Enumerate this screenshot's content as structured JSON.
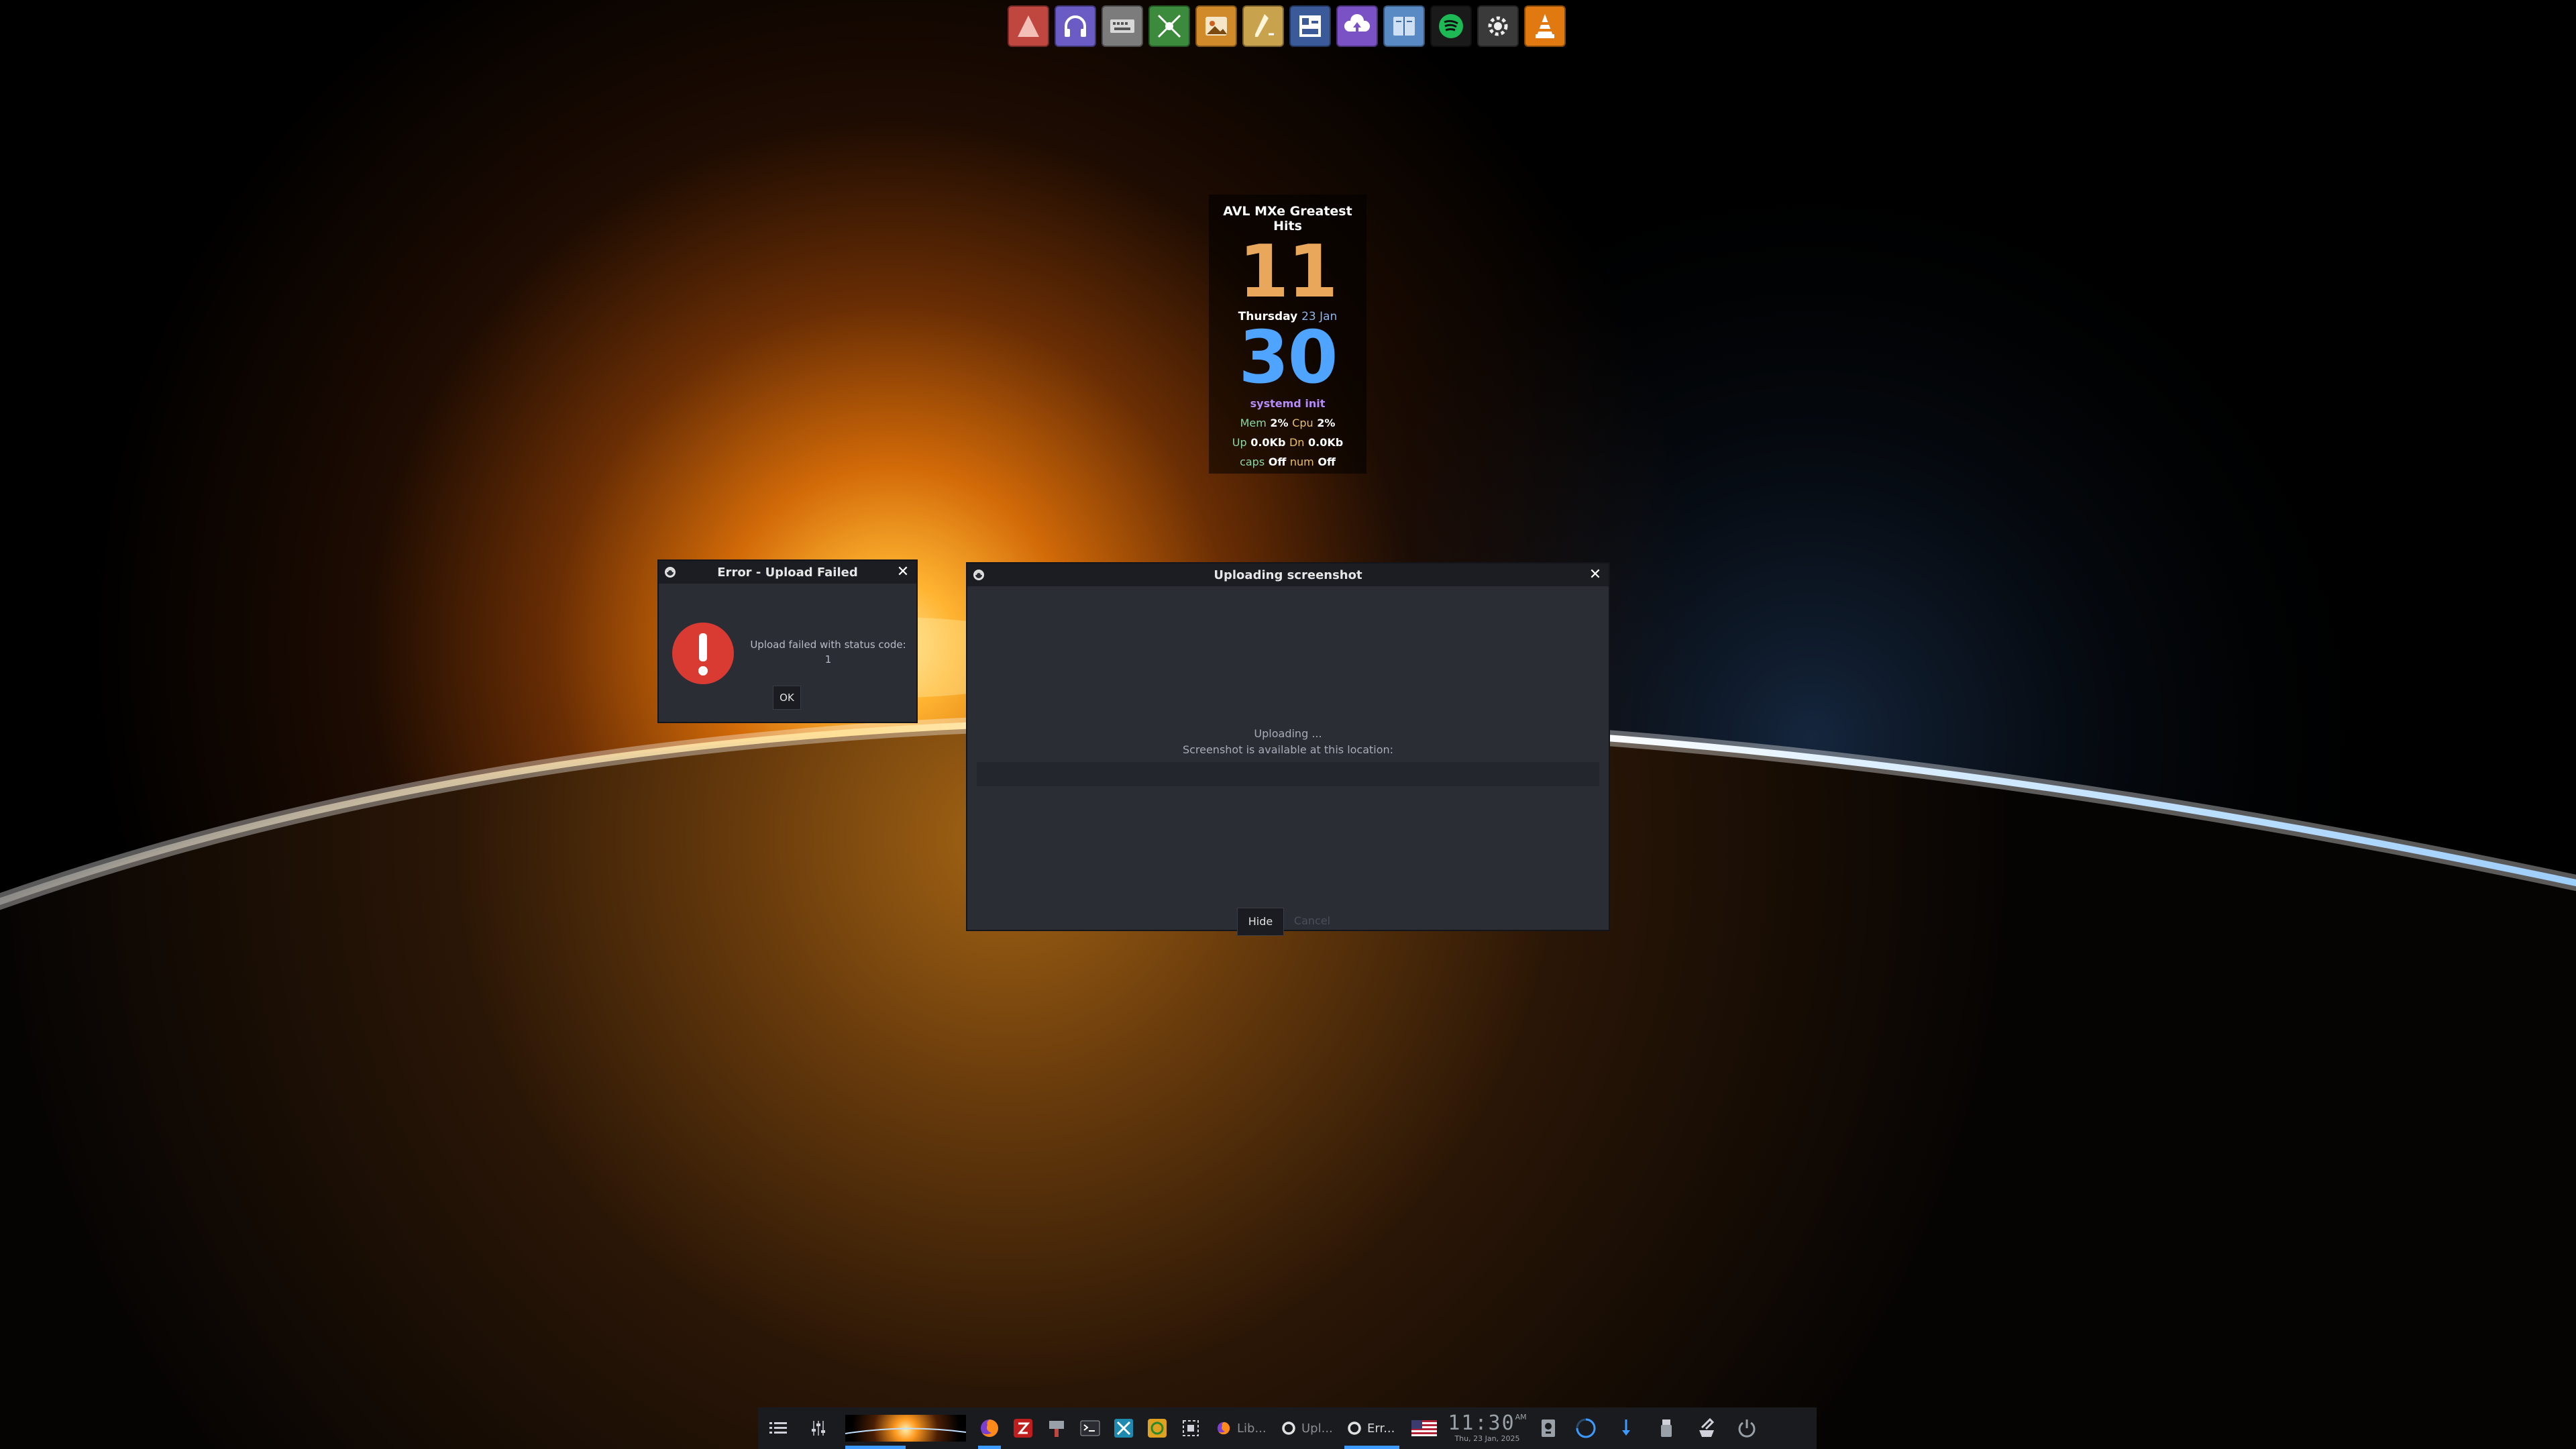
{
  "top_dock": {
    "icons": [
      {
        "name": "arc-launcher-icon",
        "bg": "#c0473f"
      },
      {
        "name": "headphones-app-icon",
        "bg": "#6a5cc4"
      },
      {
        "name": "keyboard-app-icon",
        "bg": "#7c7c7c"
      },
      {
        "name": "network-tool-icon",
        "bg": "#3c8a3c"
      },
      {
        "name": "image-viewer-icon",
        "bg": "#d08a2a"
      },
      {
        "name": "pen-tool-icon",
        "bg": "#c8a24c"
      },
      {
        "name": "terminal-keyboard-icon",
        "bg": "#3a5a9a"
      },
      {
        "name": "uploader-cloud-icon",
        "bg": "#7a52c6"
      },
      {
        "name": "book-reader-icon",
        "bg": "#5a8ac4"
      },
      {
        "name": "spotify-icon",
        "bg": "#1a1a1a"
      },
      {
        "name": "settings-gear-icon",
        "bg": "#3a3a3a"
      },
      {
        "name": "vlc-icon",
        "bg": "#e07a10"
      }
    ]
  },
  "conky": {
    "title": "AVL MXe Greatest Hits",
    "hour": "11",
    "weekday": "Thursday",
    "day_month": "23 Jan",
    "minute": "30",
    "process": "systemd init",
    "mem_label": "Mem",
    "mem_value": "2%",
    "cpu_label": "Cpu",
    "cpu_value": "2%",
    "up_label": "Up",
    "up_value": "0.0Kb",
    "dn_label": "Dn",
    "dn_value": "0.0Kb",
    "caps_label": "caps",
    "caps_value": "Off",
    "num_label": "num",
    "num_value": "Off"
  },
  "error_dialog": {
    "title": "Error - Upload Failed",
    "message_line1": "Upload failed with status code:",
    "message_line2": "1",
    "ok_label": "OK"
  },
  "upload_dialog": {
    "title": "Uploading screenshot",
    "status_line1": "Uploading ...",
    "status_line2": "Screenshot is available at this location:",
    "url_value": "",
    "hide_label": "Hide",
    "cancel_label": "Cancel"
  },
  "panel": {
    "tasks": [
      {
        "label": "Lib...",
        "active": false
      },
      {
        "label": "Upl...",
        "active": false
      },
      {
        "label": "Err...",
        "active": true
      }
    ],
    "clock_time": "11:30",
    "clock_ampm": "AM",
    "clock_date": "Thu, 23 Jan, 2025"
  },
  "colors": {
    "accent": "#3d9bff",
    "error_red": "#d93a32"
  }
}
